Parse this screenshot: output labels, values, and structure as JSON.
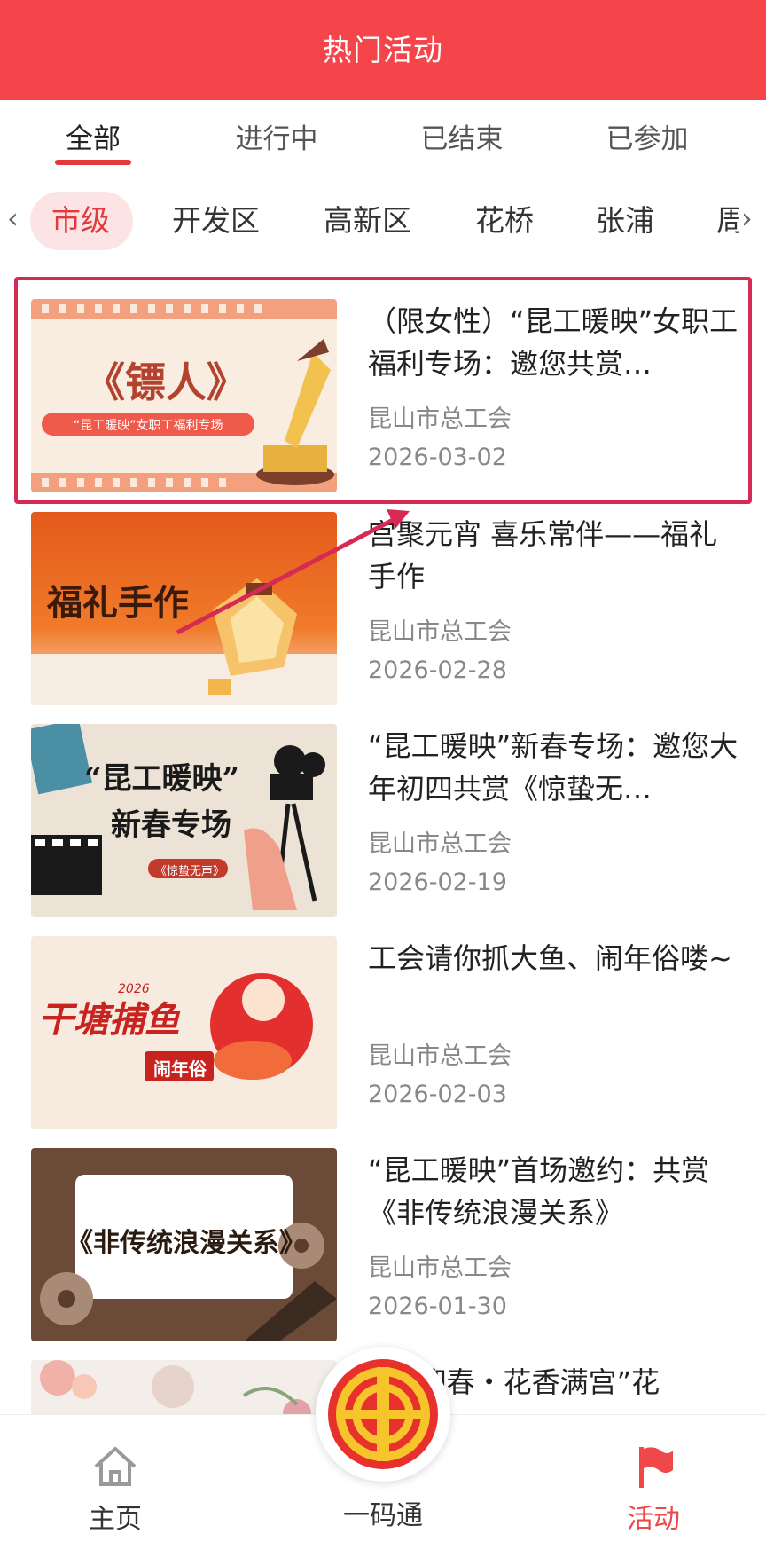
{
  "header": {
    "title": "热门活动"
  },
  "status_tabs": [
    {
      "label": "全部",
      "active": true
    },
    {
      "label": "进行中",
      "active": false
    },
    {
      "label": "已结束",
      "active": false
    },
    {
      "label": "已参加",
      "active": false
    }
  ],
  "regions": [
    {
      "label": "市级",
      "active": true
    },
    {
      "label": "开发区",
      "active": false
    },
    {
      "label": "高新区",
      "active": false
    },
    {
      "label": "花桥",
      "active": false
    },
    {
      "label": "张浦",
      "active": false
    },
    {
      "label": "周",
      "active": false
    }
  ],
  "activities": [
    {
      "title": "（限女性）“昆工暖映”女职工福利专场：邀您共赏…",
      "org": "昆山市总工会",
      "date": "2026-03-02",
      "thumb_text": "《镖人》",
      "thumb_sub": "“昆工暖映”女职工福利专场"
    },
    {
      "title": "宫聚元宵 喜乐常伴——福礼手作",
      "org": "昆山市总工会",
      "date": "2026-02-28",
      "thumb_text": "福礼手作"
    },
    {
      "title": "“昆工暖映”新春专场：邀您大年初四共赏《惊蛰无…",
      "org": "昆山市总工会",
      "date": "2026-02-19",
      "thumb_text": "“昆工暖映”",
      "thumb_sub": "新春专场",
      "thumb_tag": "《惊蛰无声》"
    },
    {
      "title": "工会请你抓大鱼、闹年俗喽~",
      "org": "昆山市总工会",
      "date": "2026-02-03",
      "thumb_text": "干塘捕鱼",
      "thumb_sub": "闹年俗",
      "thumb_year": "2026"
    },
    {
      "title": "“昆工暖映”首场邀约：共赏《非传统浪漫关系》",
      "org": "昆山市总工会",
      "date": "2026-01-30",
      "thumb_text": "《非传统浪漫关系》"
    },
    {
      "title": "“迎春・花香满宫”花",
      "org": "",
      "date": ""
    }
  ],
  "bottom_nav": [
    {
      "label": "主页",
      "icon": "home-icon",
      "active": false
    },
    {
      "label": "一码通",
      "icon": "union-logo-icon",
      "active": false
    },
    {
      "label": "活动",
      "icon": "flag-icon",
      "active": true
    }
  ],
  "colors": {
    "brand": "#f3454a",
    "accent": "#e4393c",
    "highlight": "#d42a53"
  }
}
